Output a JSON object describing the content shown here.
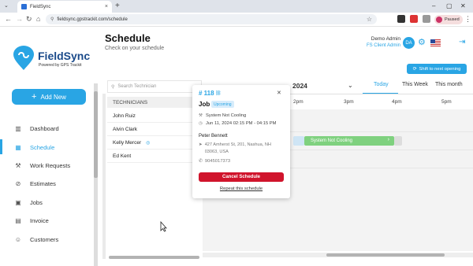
{
  "browser": {
    "tab_title": "FieldSync",
    "url": "fieldsync.gpstrackit.com/schedule",
    "profile_label": "Paused"
  },
  "sidebar": {
    "logo_name": "FieldSync",
    "logo_tagline": "Powered by GPS Trackit",
    "new_button": "Add New",
    "items": [
      {
        "label": "Dashboard",
        "icon": "dashboard-icon"
      },
      {
        "label": "Schedule",
        "icon": "calendar-icon",
        "active": true
      },
      {
        "label": "Work Requests",
        "icon": "wrench-icon"
      },
      {
        "label": "Estimates",
        "icon": "paperclip-icon"
      },
      {
        "label": "Jobs",
        "icon": "briefcase-icon"
      },
      {
        "label": "Invoice",
        "icon": "invoice-icon"
      },
      {
        "label": "Customers",
        "icon": "customers-icon"
      }
    ]
  },
  "header": {
    "title": "Schedule",
    "subtitle": "Check on your schedule",
    "user_name": "Demo Admin",
    "user_role": "FS Client Admin",
    "avatar_initials": "DA",
    "shift_button": "Shift to next opening"
  },
  "calendar": {
    "year": "2024",
    "tabs": [
      "Today",
      "This Week",
      "This month"
    ],
    "hours": [
      "2pm",
      "3pm",
      "4pm",
      "5pm"
    ],
    "event_label": "System Not Cooling"
  },
  "technicians": {
    "search_placeholder": "Search Technician",
    "header": "TECHNICIANS",
    "list": [
      "John Ruiz",
      "Alvin Clark",
      "Kelly Mercer",
      "Ed Kent"
    ]
  },
  "popup": {
    "number": "# 118",
    "job_label": "Job",
    "status": "Upcoming",
    "issue": "System Not Cooling",
    "datetime": "Jun 11, 2024 02:15 PM - 04:15 PM",
    "customer": "Peter Bennett",
    "address": "427 Amherst St, 201, Nashua, NH 03063, USA",
    "phone": "9045017373",
    "cancel_button": "Cancel Schedule",
    "repeat_link": "Repeat this schedule"
  },
  "colors": {
    "accent": "#29a5e4",
    "danger": "#d0142c",
    "event": "#7fd17f"
  }
}
